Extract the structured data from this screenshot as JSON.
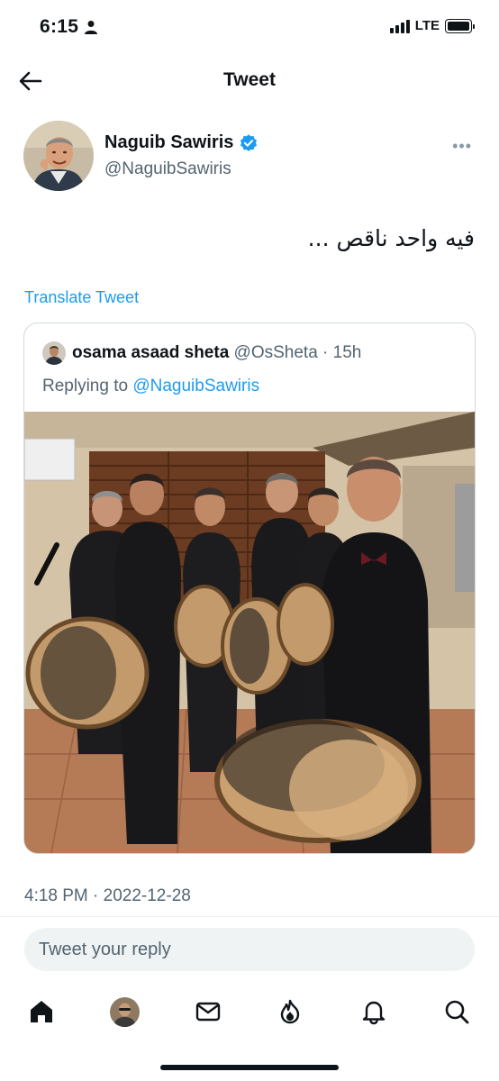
{
  "status_bar": {
    "time": "6:15",
    "network": "LTE",
    "icons": [
      "person-icon",
      "signal-icon",
      "battery-icon"
    ]
  },
  "header": {
    "title": "Tweet",
    "back_icon": "arrow-left-icon"
  },
  "tweet": {
    "author_name": "Naguib Sawiris",
    "author_handle": "@NaguibSawiris",
    "verified_icon": "verified-badge-icon",
    "more_label": "•••",
    "text": "فيه واحد ناقص ...",
    "translate_label": "Translate Tweet",
    "timestamp": "4:18 PM · 2022-12-28"
  },
  "quoted_tweet": {
    "author_name": "osama asaad sheta",
    "author_handle": "@OsSheta",
    "time": "· 15h",
    "replying_label": "Replying to",
    "replying_handle": "@NaguibSawiris"
  },
  "reply_box": {
    "placeholder": "Tweet your reply"
  },
  "tab_bar": {
    "items": [
      "home-icon",
      "profile-avatar",
      "messages-icon",
      "spaces-icon",
      "notifications-icon",
      "search-icon"
    ]
  },
  "colors": {
    "accent": "#1d9bf0",
    "text_primary": "#0f1419",
    "text_secondary": "#536471",
    "border": "#cfd9de"
  }
}
